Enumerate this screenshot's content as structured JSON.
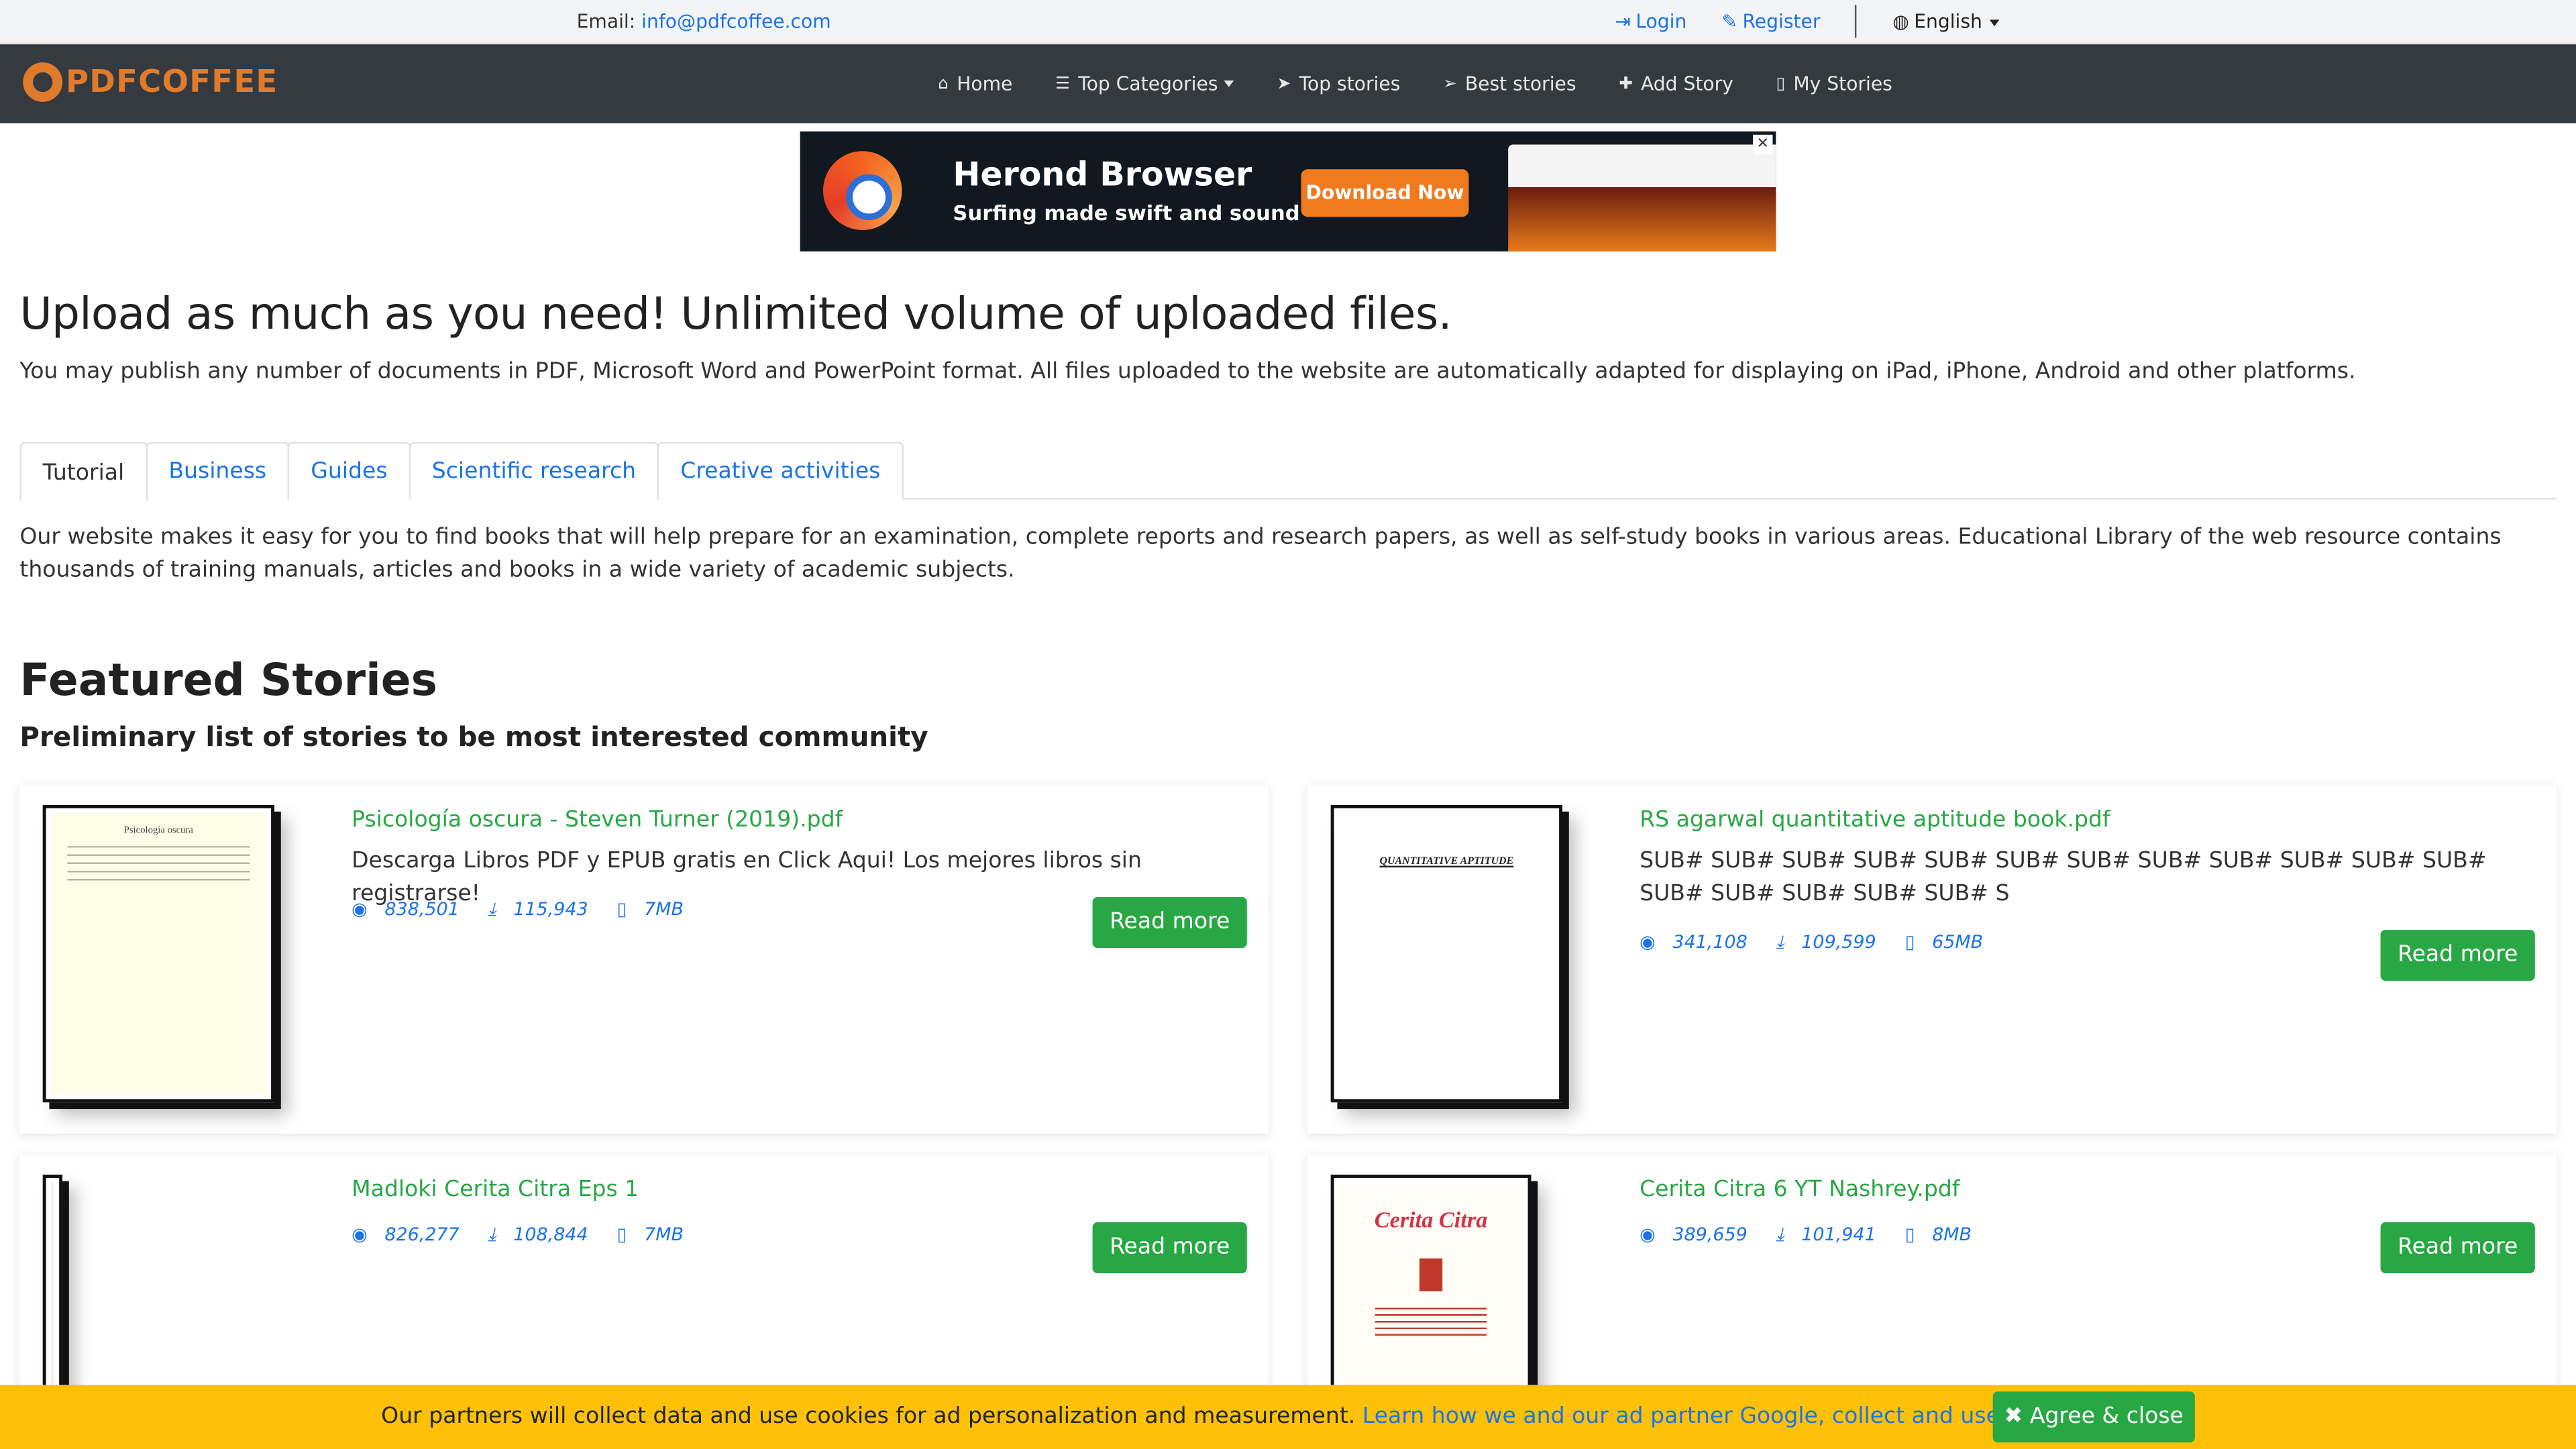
{
  "topbar": {
    "email_label": "Email:",
    "email": "info@pdfcoffee.com",
    "login": "Login",
    "register": "Register",
    "language": "English"
  },
  "navbar": {
    "logo": "PDFCOFFEE",
    "items": [
      {
        "label": "Home",
        "icon": "home-icon"
      },
      {
        "label": "Top Categories",
        "icon": "list-icon"
      },
      {
        "label": "Top stories",
        "icon": "paper-plane-icon"
      },
      {
        "label": "Best stories",
        "icon": "paper-plane-outline-icon"
      },
      {
        "label": "Add Story",
        "icon": "plus-icon"
      },
      {
        "label": "My Stories",
        "icon": "file-icon"
      }
    ]
  },
  "ad": {
    "title": "Herond Browser",
    "subtitle": "Surfing made swift and sound",
    "button": "Download Now"
  },
  "main": {
    "heading": "Upload as much as you need! Unlimited volume of uploaded files.",
    "lead": "You may publish any number of documents in PDF, Microsoft Word and PowerPoint format. All files uploaded to the website are automatically adapted for displaying on iPad, iPhone, Android and other platforms.",
    "tabs": [
      "Tutorial",
      "Business",
      "Guides",
      "Scientific research",
      "Creative activities"
    ],
    "tab_text": "Our website makes it easy for you to find books that will help prepare for an examination, complete reports and research papers, as well as self-study books in various areas. Educational Library of the web resource contains thousands of training manuals, articles and books in a wide variety of academic subjects.",
    "featured_title": "Featured Stories",
    "featured_subtitle": "Preliminary list of stories to be most interested community"
  },
  "cards": [
    {
      "title": "Psicología oscura - Steven Turner (2019).pdf",
      "description": "Descarga Libros PDF y EPUB gratis en Click Aqui! Los mejores libros sin registrarse!",
      "views": "838,501",
      "downloads": "115,943",
      "size": "7MB",
      "read_more": "Read more"
    },
    {
      "title": "RS agarwal quantitative aptitude book.pdf",
      "description": "SUB# SUB# SUB# SUB# SUB# SUB# SUB# SUB# SUB# SUB# SUB# SUB# SUB# SUB# SUB# SUB# SUB# S",
      "views": "341,108",
      "downloads": "109,599",
      "size": "65MB",
      "read_more": "Read more"
    },
    {
      "title": "Madloki Cerita Citra Eps 1",
      "description": "",
      "views": "826,277",
      "downloads": "108,844",
      "size": "7MB",
      "read_more": "Read more"
    },
    {
      "title": "Cerita Citra 6 YT Nashrey.pdf",
      "description": "",
      "views": "389,659",
      "downloads": "101,941",
      "size": "8MB",
      "read_more": "Read more"
    }
  ],
  "thumbs": {
    "psicologia_title": "Psicología oscura",
    "quant_title": "QUANTITATIVE APTITUDE",
    "cerita_title": "Cerita Citra"
  },
  "cookie": {
    "text": "Our partners will collect data and use cookies for ad personalization and measurement.",
    "link": "Learn how we and our ad partner Google, collect and use data",
    "agree": "Agree & close"
  },
  "colors": {
    "navbar": "#343a40",
    "brand": "#e07b2b",
    "link": "#1a73e8",
    "green": "#28a745",
    "cookie_bar": "#ffc107"
  }
}
